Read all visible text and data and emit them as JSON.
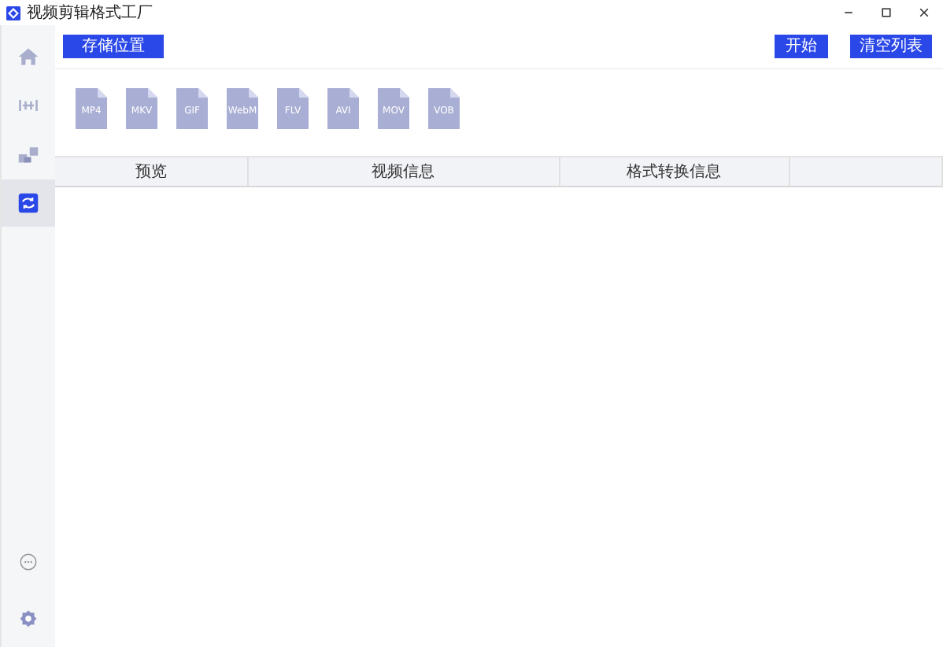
{
  "window": {
    "title": "视频剪辑格式工厂"
  },
  "sidebar": {
    "items": [
      {
        "selected": false
      },
      {
        "selected": false
      },
      {
        "selected": false
      },
      {
        "selected": true
      }
    ]
  },
  "toolbar": {
    "left_buttons": [
      "存储位置"
    ],
    "right_buttons": [
      "开始",
      "清空列表"
    ]
  },
  "formats": [
    "MP4",
    "MKV",
    "GIF",
    "WebM",
    "FLV",
    "AVI",
    "MOV",
    "VOB"
  ],
  "table": {
    "columns": [
      "预览",
      "视频信息",
      "格式转换信息",
      ""
    ]
  }
}
